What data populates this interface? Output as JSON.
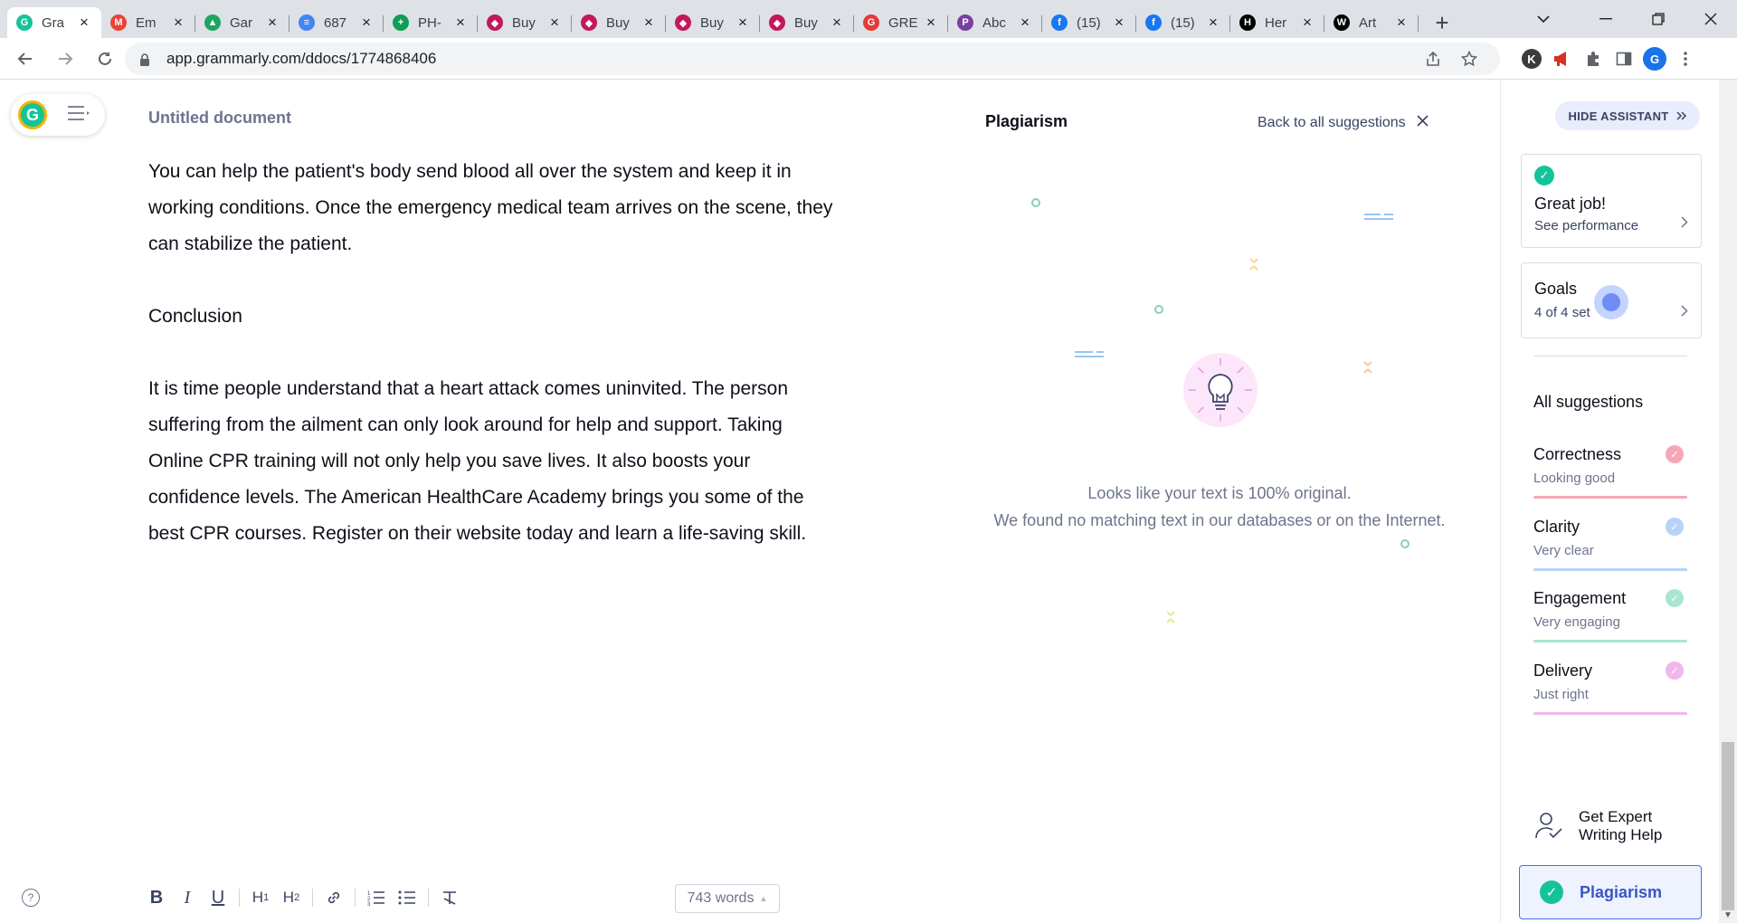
{
  "browser": {
    "tabs": [
      {
        "title": "Gra",
        "icon": "grammarly-icon",
        "color": "#15c39a",
        "glyph": "G",
        "active": true
      },
      {
        "title": "Em",
        "icon": "gmail-icon",
        "color": "#ea4335",
        "glyph": "M"
      },
      {
        "title": "Gar",
        "icon": "google-drive-icon",
        "color": "#1fa463",
        "glyph": "▲"
      },
      {
        "title": "687",
        "icon": "google-docs-icon",
        "color": "#4285f4",
        "glyph": "≡"
      },
      {
        "title": "PH-",
        "icon": "google-sheets-icon",
        "color": "#0f9d58",
        "glyph": "+"
      },
      {
        "title": "Buy",
        "icon": "shop-icon",
        "color": "#c2185b",
        "glyph": "◆"
      },
      {
        "title": "Buy",
        "icon": "shop-icon",
        "color": "#c2185b",
        "glyph": "◆"
      },
      {
        "title": "Buy",
        "icon": "shop-icon",
        "color": "#c2185b",
        "glyph": "◆"
      },
      {
        "title": "Buy",
        "icon": "shop-icon",
        "color": "#c2185b",
        "glyph": "◆"
      },
      {
        "title": "GRE",
        "icon": "grammarly-red-icon",
        "color": "#e53935",
        "glyph": "G"
      },
      {
        "title": "Abc",
        "icon": "pocket-icon",
        "color": "#7b3fa0",
        "glyph": "P"
      },
      {
        "title": "(15)",
        "icon": "facebook-icon",
        "color": "#1877f2",
        "glyph": "f"
      },
      {
        "title": "(15)",
        "icon": "facebook-icon",
        "color": "#1877f2",
        "glyph": "f"
      },
      {
        "title": "Her",
        "icon": "h-icon",
        "color": "#000000",
        "glyph": "H"
      },
      {
        "title": "Art",
        "icon": "wikipedia-icon",
        "color": "#000000",
        "glyph": "W"
      }
    ],
    "url": "app.grammarly.com/ddocs/1774868406",
    "profile_initial": "G",
    "ext_initial": "K"
  },
  "document": {
    "title": "Untitled document",
    "paragraphs": [
      "You can help the patient's body send blood all over the system and keep it in working conditions. Once the emergency medical team arrives on the scene, they can stabilize the patient.",
      "Conclusion",
      "It is time people understand that a heart attack comes uninvited. The person suffering from the ailment can only look around for help and support. Taking Online CPR training will not only help you save lives. It also boosts your confidence levels. The American HealthCare Academy brings you some of the best CPR courses. Register on their website today and learn a life-saving skill."
    ],
    "word_count": "743 words"
  },
  "plagiarism": {
    "title": "Plagiarism",
    "back_label": "Back to all suggestions",
    "msg_line1": "Looks like your text is 100% original.",
    "msg_line2": "We found no matching text in our databases or on the Internet."
  },
  "sidebar": {
    "hide_label": "HIDE ASSISTANT",
    "performance": {
      "title": "Great job!",
      "subtitle": "See performance"
    },
    "goals": {
      "title": "Goals",
      "subtitle": "4 of 4 set"
    },
    "all_suggestions": "All suggestions",
    "categories": [
      {
        "name": "Correctness",
        "status": "Looking good",
        "color": "#f7a6b8"
      },
      {
        "name": "Clarity",
        "status": "Very clear",
        "color": "#b5d3f7"
      },
      {
        "name": "Engagement",
        "status": "Very engaging",
        "color": "#a9e5d3"
      },
      {
        "name": "Delivery",
        "status": "Just right",
        "color": "#f2b6ee"
      }
    ],
    "expert_label": "Get Expert Writing Help",
    "plagiarism_label": "Plagiarism"
  }
}
